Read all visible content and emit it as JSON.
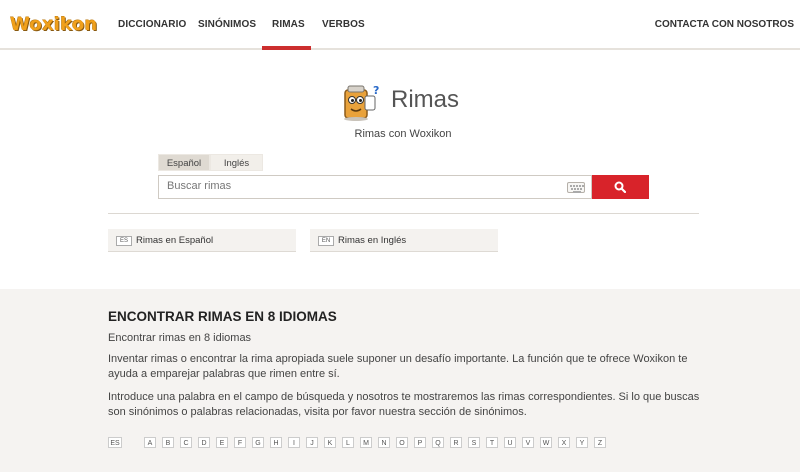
{
  "logo": "Woxikon",
  "nav": {
    "items": [
      "DICCIONARIO",
      "SINÓNIMOS",
      "RIMAS",
      "VERBOS"
    ],
    "active": "RIMAS",
    "contact": "CONTACTA CON NOSOTROS"
  },
  "hero": {
    "title": "Rimas",
    "subtitle": "Rimas con Woxikon",
    "icon": "rhyme-mascot-icon"
  },
  "search": {
    "tabs": [
      "Español",
      "Inglés"
    ],
    "active_tab": "Español",
    "placeholder": "Buscar rimas",
    "keyboard_icon": "keyboard-icon",
    "button_icon": "search-icon"
  },
  "quick_links": [
    {
      "code": "ES",
      "label": "Rimas en Español"
    },
    {
      "code": "EN",
      "label": "Rimas en Inglés"
    }
  ],
  "info": {
    "heading": "ENCONTRAR RIMAS EN 8 IDIOMAS",
    "sub": "Encontrar rimas en 8 idiomas",
    "p1": "Inventar rimas o encontrar la rima apropiada suele suponer un desafío importante. La función que te ofrece Woxikon te ayuda a emparejar palabras que rimen entre sí.",
    "p2": "Introduce una palabra en el campo de búsqueda y nosotros te mostraremos las rimas correspondientes. Si lo que buscas son sinónimos o palabras relacionadas, visita por favor nuestra sección de sinónimos."
  },
  "alphabet": {
    "lang": "ES",
    "letters": [
      "A",
      "B",
      "C",
      "D",
      "E",
      "F",
      "G",
      "H",
      "I",
      "J",
      "K",
      "L",
      "M",
      "N",
      "O",
      "P",
      "Q",
      "R",
      "S",
      "T",
      "U",
      "V",
      "W",
      "X",
      "Y",
      "Z"
    ]
  },
  "colors": {
    "accent_red": "#d8232a",
    "logo_orange": "#f0a01b",
    "section_bg": "#f5f3f1"
  }
}
